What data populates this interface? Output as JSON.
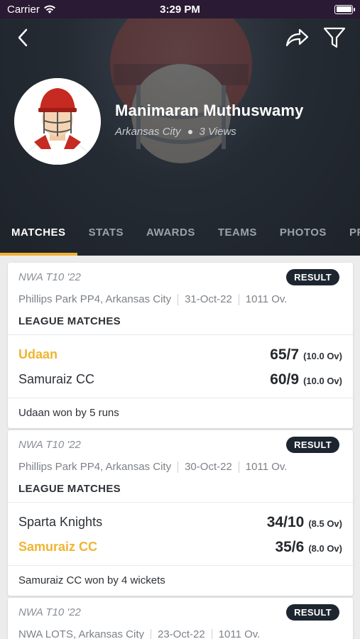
{
  "status_bar": {
    "carrier": "Carrier",
    "time": "3:29 PM"
  },
  "profile": {
    "name": "Manimaran Muthuswamy",
    "city": "Arkansas City",
    "views": "3 Views"
  },
  "tabs": [
    "MATCHES",
    "STATS",
    "AWARDS",
    "TEAMS",
    "PHOTOS",
    "PROFILE"
  ],
  "active_tab": "MATCHES",
  "colors": {
    "accent": "#f2b134",
    "winner": "#efb533",
    "badge": "#1d2630",
    "header": "#252b33"
  },
  "matches": [
    {
      "series": "NWA T10 '22",
      "badge": "RESULT",
      "venue": "Phillips Park PP4, Arkansas City",
      "date": "31-Oct-22",
      "overs": "1011 Ov.",
      "match_type": "LEAGUE MATCHES",
      "teams": [
        {
          "name": "Udaan",
          "score": "65/7",
          "overs": "(10.0 Ov)",
          "winner": true
        },
        {
          "name": "Samuraiz CC",
          "score": "60/9",
          "overs": "(10.0 Ov)",
          "winner": false
        }
      ],
      "summary": "Udaan won by 5 runs"
    },
    {
      "series": "NWA T10 '22",
      "badge": "RESULT",
      "venue": "Phillips Park PP4, Arkansas City",
      "date": "30-Oct-22",
      "overs": "1011 Ov.",
      "match_type": "LEAGUE MATCHES",
      "teams": [
        {
          "name": "Sparta Knights",
          "score": "34/10",
          "overs": "(8.5 Ov)",
          "winner": false
        },
        {
          "name": "Samuraiz CC",
          "score": "35/6",
          "overs": "(8.0 Ov)",
          "winner": true
        }
      ],
      "summary": "Samuraiz CC won by 4 wickets"
    },
    {
      "series": "NWA T10 '22",
      "badge": "RESULT",
      "venue": "NWA LOTS, Arkansas City",
      "date": "23-Oct-22",
      "overs": "1011 Ov."
    }
  ]
}
